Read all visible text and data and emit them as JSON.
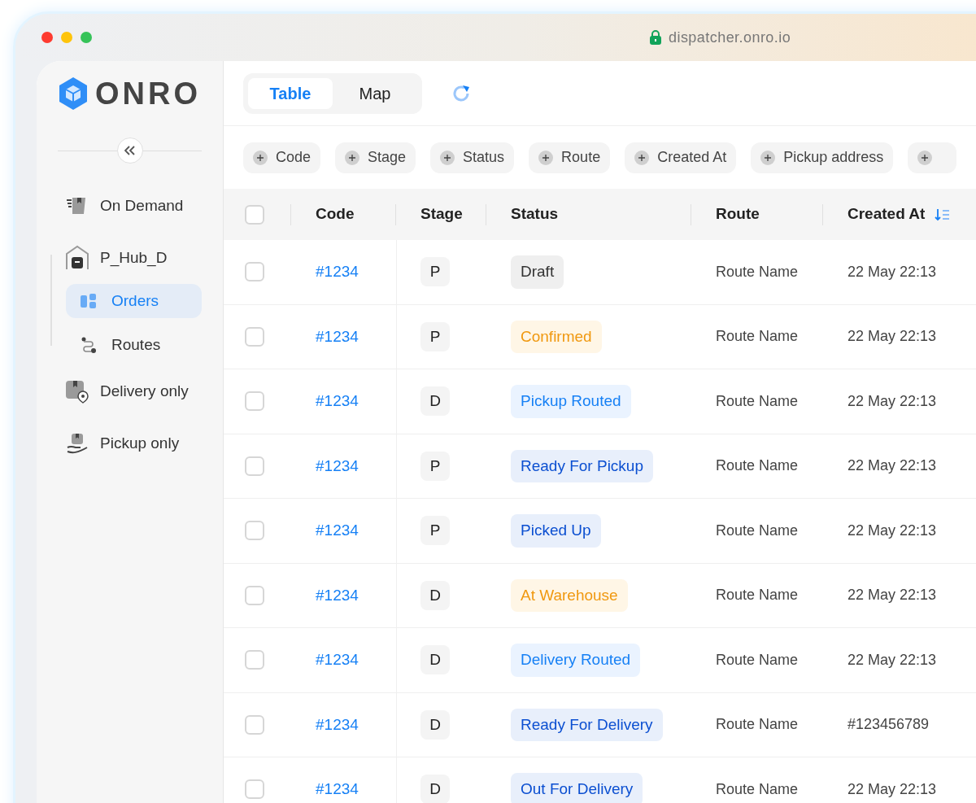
{
  "browser": {
    "url": "dispatcher.onro.io"
  },
  "logo": {
    "text": "ONRO"
  },
  "sidebar": {
    "items": [
      {
        "label": "On Demand",
        "kind": "demand",
        "selected": false
      },
      {
        "label": "P_Hub_D",
        "kind": "hub",
        "selected": false,
        "children": [
          {
            "label": "Orders",
            "kind": "orders",
            "selected": true
          },
          {
            "label": "Routes",
            "kind": "routes",
            "selected": false
          }
        ]
      },
      {
        "label": "Delivery only",
        "kind": "delivery",
        "selected": false
      },
      {
        "label": "Pickup only",
        "kind": "pickup",
        "selected": false
      }
    ]
  },
  "view_tabs": [
    {
      "label": "Table",
      "selected": true
    },
    {
      "label": "Map",
      "selected": false
    }
  ],
  "filters": [
    "Code",
    "Stage",
    "Status",
    "Route",
    "Created At",
    "Pickup address"
  ],
  "table": {
    "select_all_checked": false,
    "columns": [
      {
        "label": "Code"
      },
      {
        "label": "Stage"
      },
      {
        "label": "Status"
      },
      {
        "label": "Route"
      },
      {
        "label": "Created At",
        "sorted": true
      }
    ],
    "rows": [
      {
        "checked": false,
        "code": "#1234",
        "stage": "P",
        "status": "Draft",
        "color": "#333333",
        "route": "Route Name",
        "created": "22 May 22:13"
      },
      {
        "checked": false,
        "code": "#1234",
        "stage": "P",
        "status": "Confirmed",
        "color": "#f0980f",
        "route": "Route Name",
        "created": "22 May 22:13"
      },
      {
        "checked": false,
        "code": "#1234",
        "stage": "D",
        "status": "Pickup Routed",
        "color": "#1680f5",
        "route": "Route Name",
        "created": "22 May 22:13"
      },
      {
        "checked": false,
        "code": "#1234",
        "stage": "P",
        "status": "Ready For Pickup",
        "color": "#0b4fd1",
        "route": "Route Name",
        "created": "22 May 22:13"
      },
      {
        "checked": false,
        "code": "#1234",
        "stage": "P",
        "status": "Picked Up",
        "color": "#0b4fd1",
        "route": "Route Name",
        "created": "22 May 22:13"
      },
      {
        "checked": false,
        "code": "#1234",
        "stage": "D",
        "status": "At Warehouse",
        "color": "#f0980f",
        "route": "Route Name",
        "created": "22 May 22:13"
      },
      {
        "checked": false,
        "code": "#1234",
        "stage": "D",
        "status": "Delivery Routed",
        "color": "#1680f5",
        "route": "Route Name",
        "created": "22 May 22:13"
      },
      {
        "checked": false,
        "code": "#1234",
        "stage": "D",
        "status": "Ready For Delivery",
        "color": "#0b4fd1",
        "route": "Route Name",
        "created": "#123456789"
      },
      {
        "checked": false,
        "code": "#1234",
        "stage": "D",
        "status": "Out For Delivery",
        "color": "#0b4fd1",
        "route": "Route Name",
        "created": "22 May 22:13"
      }
    ]
  }
}
